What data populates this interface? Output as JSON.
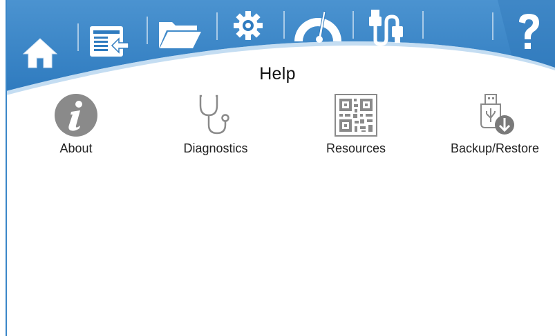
{
  "header": {
    "title": "Help",
    "nav": [
      {
        "id": "home",
        "icon": "home-icon"
      },
      {
        "id": "log",
        "icon": "log-export-icon"
      },
      {
        "id": "files",
        "icon": "folder-icon"
      },
      {
        "id": "settings",
        "icon": "gear-icon"
      },
      {
        "id": "gauge",
        "icon": "gauge-icon"
      },
      {
        "id": "usb",
        "icon": "usb-cable-icon"
      },
      {
        "id": "help",
        "icon": "question-mark-icon",
        "active": true
      }
    ]
  },
  "tiles": [
    {
      "label": "About",
      "icon": "info-icon"
    },
    {
      "label": "Diagnostics",
      "icon": "stethoscope-icon"
    },
    {
      "label": "Resources",
      "icon": "qr-code-icon"
    },
    {
      "label": "Backup/Restore",
      "icon": "usb-download-icon"
    }
  ],
  "colors": {
    "header_blue": "#3a86c8",
    "header_dark": "#1f6fb3",
    "icon_gray": "#8a8a8a",
    "background": "#ffffff"
  }
}
